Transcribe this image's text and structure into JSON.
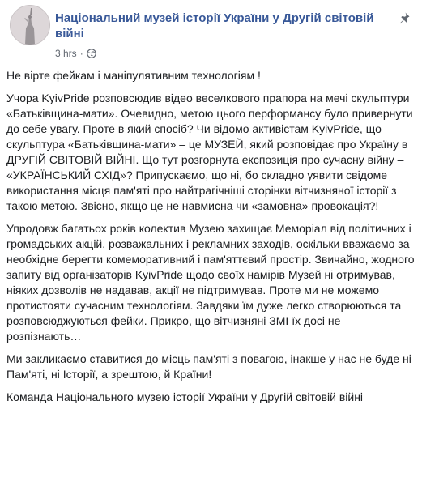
{
  "post": {
    "page_name": "Національний музей історії України у Другій світовій війні",
    "timestamp": "3 hrs",
    "separator": "·",
    "privacy_icon": "globe-icon",
    "pin_icon": "pin-icon",
    "avatar_icon": "page-avatar",
    "paragraphs": [
      "Не вірте фейкам і маніпулятивним технологіям !",
      "Учора KyivPride розповсюдив відео веселкового прапора на мечі скульптури «Батьківщина-мати». Очевидно, метою цього перформансу було привернути до себе увагу. Проте в який спосіб? Чи відомо активістам KyivPride, що скульптура «Батьківщина-мати» – це МУЗЕЙ, який розповідає про Україну в ДРУГІЙ СВІТОВІЙ ВІЙНІ. Що тут розгорнута експозиція про сучасну війну – «УКРАЇНСЬКИЙ СХІД»? Припускаємо, що ні, бо складно уявити свідоме використання місця пам'яті про найтрагічніші сторінки вітчизняної історії з такою метою. Звісно, якщо це не навмисна чи «замовна» провокація?!",
      "Упродовж багатьох років колектив Музею захищає Меморіал від політичних і громадських акцій, розважальних і рекламних заходів, оскільки вважаємо за необхідне берегти комеморативний і пам'яттєвий простір. Звичайно, жодного запиту від організаторів KyivPride щодо своїх намірів Музей ні отримував, ніяких дозволів не надавав, акції не підтримував. Проте ми не можемо протистояти сучасним технологіям. Завдяки їм дуже легко створюються та розповсюджуються фейки. Прикро, що вітчизняні ЗМІ їх досі не розпізнають…",
      "Ми закликаємо ставитися до місць пам'яті з повагою, інакше у нас не буде ні Пам'яті, ні Історії, а зрештою, й Країни!",
      "Команда Національного музею історії України у Другій світовій війні"
    ]
  },
  "colors": {
    "link": "#385898",
    "text": "#1c1e21",
    "meta": "#616770",
    "background": "#ffffff"
  }
}
